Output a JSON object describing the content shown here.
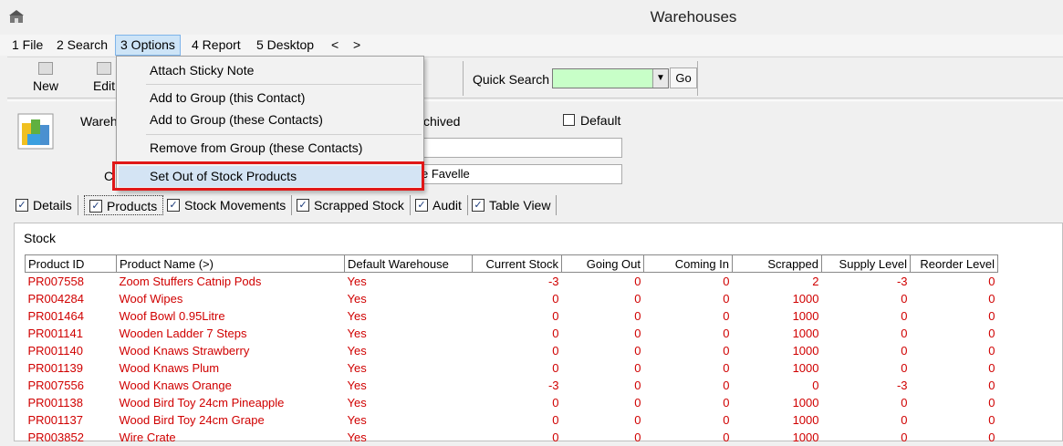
{
  "window": {
    "title": "Warehouses"
  },
  "menubar": {
    "items": [
      "1 File",
      "2 Search",
      "3 Options",
      "4 Report",
      "5 Desktop",
      "<",
      ">"
    ]
  },
  "toolbar": {
    "new_label": "New",
    "edit_label": "Edit",
    "quick_search_label": "Quick Search",
    "go_label": "Go"
  },
  "form": {
    "warehouse_label": "Wareh",
    "contact_label": "C",
    "archived_label": "chived",
    "default_label": "Default",
    "contact_value": "e Favelle"
  },
  "tabs": [
    "Details",
    "Products",
    "Stock Movements",
    "Scrapped Stock",
    "Audit",
    "Table View"
  ],
  "stock": {
    "label": "Stock",
    "columns": [
      "Product ID",
      "Product Name (>)",
      "Default Warehouse",
      "Current Stock",
      "Going Out",
      "Coming In",
      "Scrapped",
      "Supply Level",
      "Reorder Level"
    ],
    "rows": [
      [
        "PR007558",
        "Zoom Stuffers Catnip Pods",
        "Yes",
        "-3",
        "0",
        "0",
        "2",
        "-3",
        "0"
      ],
      [
        "PR004284",
        "Woof Wipes",
        "Yes",
        "0",
        "0",
        "0",
        "1000",
        "0",
        "0"
      ],
      [
        "PR001464",
        "Woof Bowl 0.95Litre",
        "Yes",
        "0",
        "0",
        "0",
        "1000",
        "0",
        "0"
      ],
      [
        "PR001141",
        "Wooden Ladder 7 Steps",
        "Yes",
        "0",
        "0",
        "0",
        "1000",
        "0",
        "0"
      ],
      [
        "PR001140",
        "Wood Knaws Strawberry",
        "Yes",
        "0",
        "0",
        "0",
        "1000",
        "0",
        "0"
      ],
      [
        "PR001139",
        "Wood Knaws Plum",
        "Yes",
        "0",
        "0",
        "0",
        "1000",
        "0",
        "0"
      ],
      [
        "PR007556",
        "Wood Knaws Orange",
        "Yes",
        "-3",
        "0",
        "0",
        "0",
        "-3",
        "0"
      ],
      [
        "PR001138",
        "Wood Bird Toy 24cm Pineapple",
        "Yes",
        "0",
        "0",
        "0",
        "1000",
        "0",
        "0"
      ],
      [
        "PR001137",
        "Wood Bird Toy 24cm Grape",
        "Yes",
        "0",
        "0",
        "0",
        "1000",
        "0",
        "0"
      ],
      [
        "PR003852",
        "Wire Crate",
        "Yes",
        "0",
        "0",
        "0",
        "1000",
        "0",
        "0"
      ]
    ]
  },
  "options_menu": {
    "items": [
      "Attach Sticky Note",
      "Add to Group (this Contact)",
      "Add to Group (these Contacts)",
      "Remove from Group (these Contacts)",
      "Set Out of Stock Products"
    ]
  }
}
